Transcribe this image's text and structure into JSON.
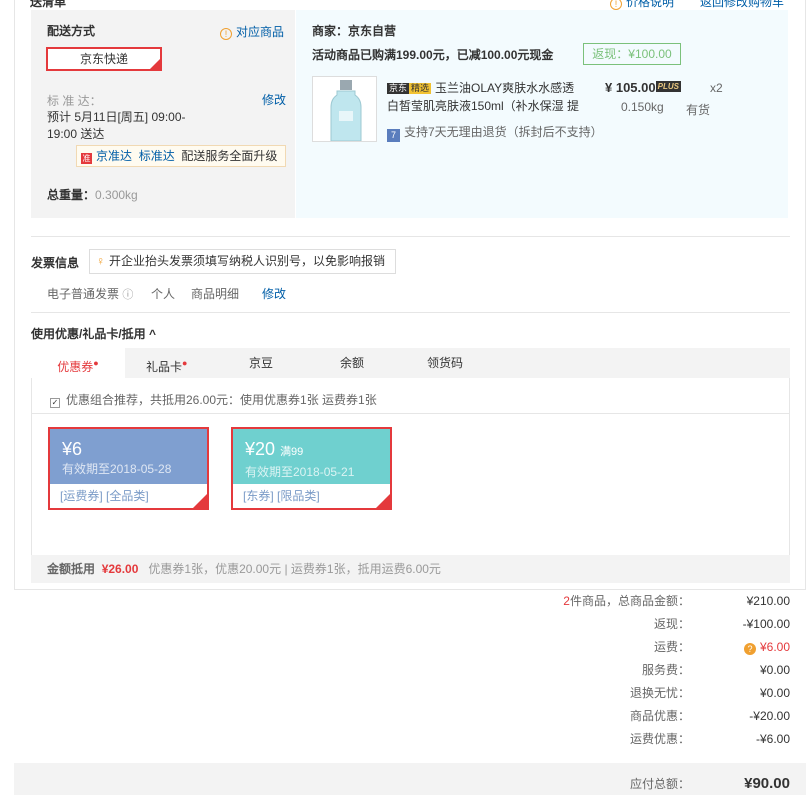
{
  "header": {
    "left_clip": "送清单",
    "price_note": "价格说明",
    "back_cart": "返回修改购物车"
  },
  "delivery": {
    "title": "配送方式",
    "related_goods": "对应商品",
    "method": "京东快递",
    "standard_label": "标 准 达：",
    "modify": "修改",
    "eta_line1": "预计 5月11日[周五] 09:00-",
    "eta_line2": "19:00 送达",
    "tip_brand1": "京准达",
    "tip_brand2": "标准达",
    "tip_text": "配送服务全面升级",
    "weight_label": "总重量：",
    "weight_value": "0.300kg"
  },
  "merchant": {
    "label": "商家：京东自营",
    "promo": "活动商品已购满199.00元，已减100.00元现金",
    "cashback": "返现：¥100.00"
  },
  "product": {
    "tag_jd": "京东",
    "tag_jx": "精选",
    "name_line1": "玉兰油OLAY爽肤水水感透",
    "name_line2": "白皙莹肌亮肤液150ml（补水保湿 提",
    "price": "¥ 105.00",
    "plus": "PLUS",
    "qty": "x2",
    "weight": "0.150kg",
    "stock": "有货",
    "return_icon": "7",
    "return_text": "支持7天无理由退货（拆封后不支持）"
  },
  "invoice": {
    "title": "发票信息",
    "tip": "开企业抬头发票须填写纳税人识别号，以免影响报销",
    "type": "电子普通发票",
    "person": "个人",
    "detail": "商品明细",
    "modify": "修改"
  },
  "discount": {
    "title": "使用优惠/礼品卡/抵用 ^",
    "tabs": [
      "优惠券",
      "礼品卡",
      "京豆",
      "余额",
      "领货码"
    ],
    "recommend": "优惠组合推荐，共抵用26.00元：使用优惠券1张 运费券1张",
    "coupons": [
      {
        "amount": "¥6",
        "threshold": "",
        "expiry": "有效期至2018-05-28",
        "tags": "[运费券] [全品类]",
        "color": "#7f9fd0"
      },
      {
        "amount": "¥20",
        "threshold": "满99",
        "expiry": "有效期至2018-05-21",
        "tags": "[东券] [限品类]",
        "color": "#6fd0cf"
      }
    ],
    "deduct_label": "金额抵用",
    "deduct_value": "¥26.00",
    "deduct_detail": "优惠券1张，优惠20.00元 | 运费券1张，抵用运费6.00元"
  },
  "summary": {
    "count": "2",
    "goods_label": "件商品，总商品金额：",
    "goods_value": "¥210.00",
    "cashback_label": "返现：",
    "cashback_value": "-¥100.00",
    "shipping_label": "运费：",
    "shipping_value": "¥6.00",
    "service_label": "服务费：",
    "service_value": "¥0.00",
    "exchange_label": "退换无忧：",
    "exchange_value": "¥0.00",
    "goods_discount_label": "商品优惠：",
    "goods_discount_value": "-¥20.00",
    "ship_discount_label": "运费优惠：",
    "ship_discount_value": "-¥6.00",
    "total_label": "应付总额：",
    "total_value": "¥90.00"
  },
  "colors": {
    "accent": "#e4393c",
    "link": "#005ea7",
    "cashback_green": "#7bc17b"
  }
}
